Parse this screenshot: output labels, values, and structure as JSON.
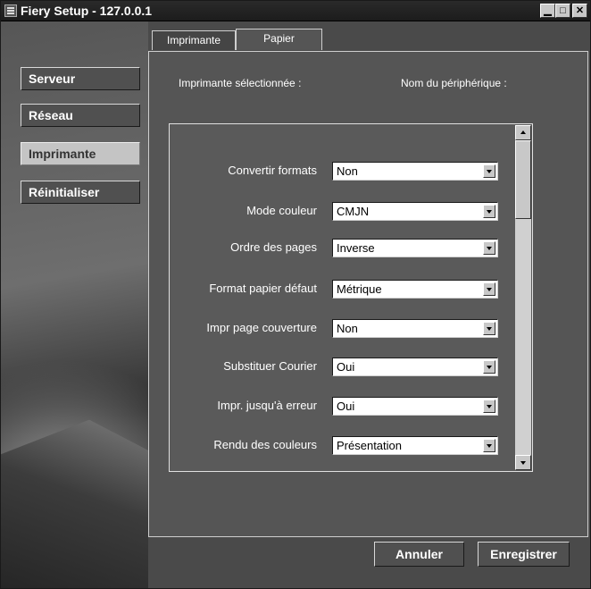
{
  "window": {
    "title": "Fiery Setup - 127.0.0.1",
    "controls": {
      "minimize": "▁",
      "maximize": "□",
      "close": "✕"
    }
  },
  "sidebar": {
    "items": [
      {
        "label": "Serveur",
        "active": false
      },
      {
        "label": "Réseau",
        "active": false
      },
      {
        "label": "Imprimante",
        "active": true
      },
      {
        "label": "Réinitialiser",
        "active": false
      }
    ]
  },
  "tabs": [
    {
      "label": "Imprimante",
      "active": false
    },
    {
      "label": "Papier",
      "active": true
    }
  ],
  "main": {
    "printer_selected_label": "Imprimante sélectionnée :",
    "device_name_label": "Nom du périphérique :",
    "settings": [
      {
        "label": "Convertir formats",
        "value": "Non"
      },
      {
        "label": "Mode couleur",
        "value": "CMJN"
      },
      {
        "label": "Ordre des pages",
        "value": "Inverse"
      },
      {
        "label": "Format papier défaut",
        "value": "Métrique"
      },
      {
        "label": "Impr page couverture",
        "value": "Non"
      },
      {
        "label": "Substituer Courier",
        "value": "Oui"
      },
      {
        "label": "Impr. jusqu'à erreur",
        "value": "Oui"
      },
      {
        "label": "Rendu des couleurs",
        "value": "Présentation"
      }
    ]
  },
  "footer": {
    "cancel_label": "Annuler",
    "save_label": "Enregistrer"
  }
}
